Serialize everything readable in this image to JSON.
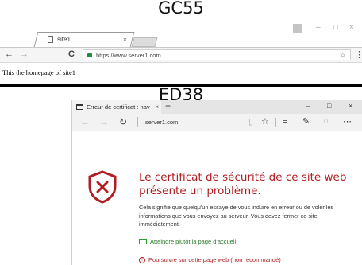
{
  "captions": {
    "top": "GC55",
    "bottom": "ED38"
  },
  "chrome": {
    "tab_title": "site1",
    "tab_close": "×",
    "url": "https://www.server1.com",
    "page_text": "This the homepage of site1",
    "buttons": {
      "back": "←",
      "forward": "→",
      "reload": "C",
      "star": "☆",
      "menu": "⋮",
      "minimize": "–",
      "maximize": "□",
      "close": "×",
      "user": "👤"
    }
  },
  "edge": {
    "tab_title": "Erreur de certificat : nav",
    "tab_close": "×",
    "new_tab": "+",
    "address": "server1.com",
    "window": {
      "minimize": "–",
      "maximize": "□",
      "close": "×"
    },
    "nav": {
      "back": "←",
      "forward": "→",
      "refresh": "↻"
    },
    "tools": {
      "reading": "▯",
      "favorite": "☆",
      "hub": "≡",
      "note": "✎",
      "share": "⌂",
      "more": "⋯"
    },
    "heading": "Le certificat de sécurité de ce site web présente un problème.",
    "body": "Cela signifie que quelqu'un essaye de vous induire en erreur ou de voler les informations que vous envoyez au serveur. Vous devez fermer ce site immédiatement.",
    "link_home": "Atteindre plutôt la page d'accueil",
    "link_continue": "Poursuivre sur cette page web (non recommandé)",
    "colors": {
      "danger": "#b01e22",
      "safe": "#2b7a2b"
    }
  }
}
